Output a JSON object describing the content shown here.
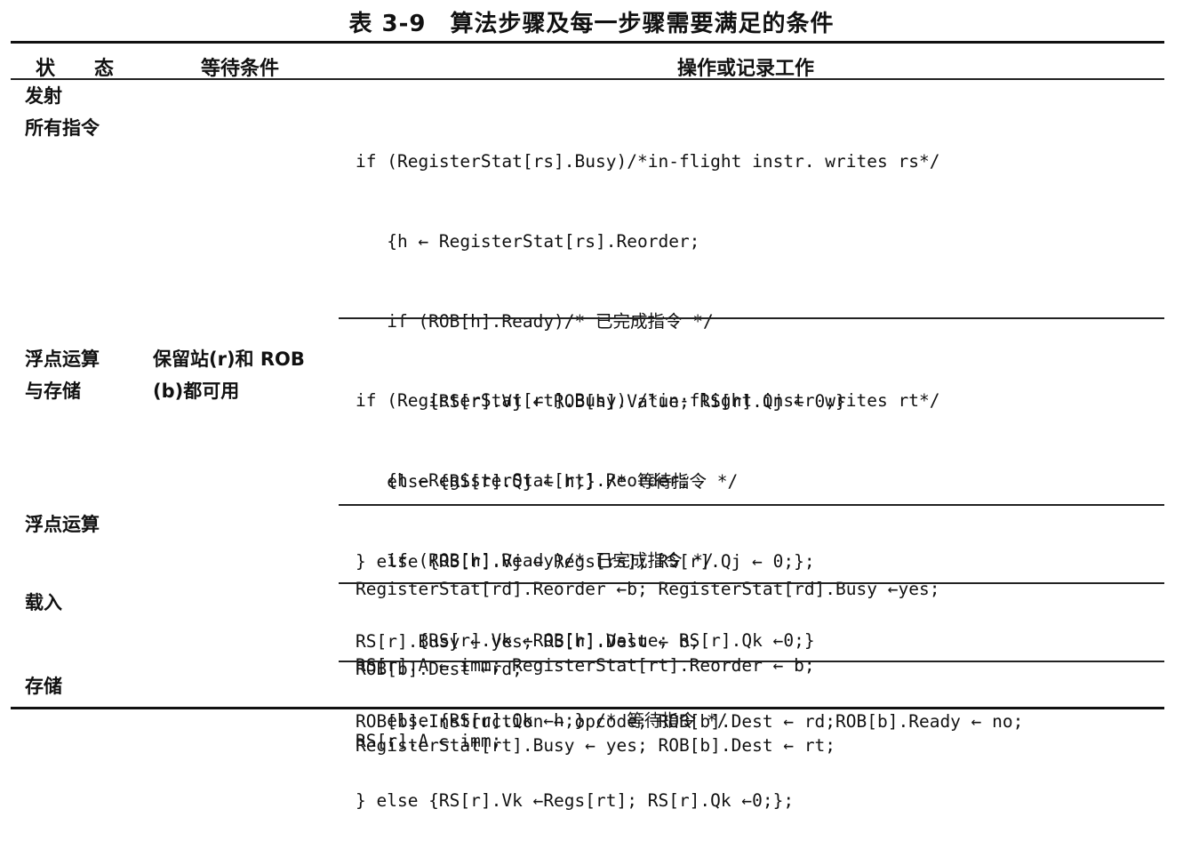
{
  "title": "表 3-9　算法步骤及每一步骤需要满足的条件",
  "columns": {
    "state": "状　　态",
    "wait": "等待条件",
    "action": "操作或记录工作"
  },
  "rows": [
    {
      "state": [
        "发射",
        "所有指令"
      ],
      "wait": [],
      "code": [
        "if (RegisterStat[rs].Busy)/*in-flight instr. writes rs*/",
        "   {h ← RegisterStat[rs].Reorder;",
        "   if (ROB[h].Ready)/* 已完成指令 */",
        "       {RS[r].Vj ← ROB[h].Value; RS[r].Qj ← 0;}",
        "   else {RS[r].Qj ← h;} /* 等待指令 */",
        "} else {RS[r].Vj ← Regs[rs]; RS[r].Qj ← 0;};",
        "RS[r].Busy ← yes; RS[r].Dest ← b;",
        "ROB[b].Instruction ← opcode; ROB[b].Dest ← rd;ROB[b].Ready ← no;"
      ]
    },
    {
      "state": [
        "浮点运算",
        "与存储"
      ],
      "wait": [
        "保留站(r)和 ROB",
        "(b)都可用"
      ],
      "code": [
        "if (RegisterStat[rt].Busy) /*in-flight instr writes rt*/",
        "   {h ←RegisterStat[rt].Reorder;",
        "   if (ROB[h].Ready)/* 已完成指令 */",
        "      {RS[r].Vk ←ROB[h].Value; RS[r].Qk ←0;}",
        "   else {RS[r].Qk ←h;} /* 等待指令 */",
        "} else {RS[r].Vk ←Regs[rt]; RS[r].Qk ←0;};"
      ]
    },
    {
      "state": [
        "浮点运算"
      ],
      "wait": [],
      "code": [
        "RegisterStat[rd].Reorder ←b; RegisterStat[rd].Busy ←yes;",
        "ROB[b].Dest ←rd;"
      ]
    },
    {
      "state": [
        "载入"
      ],
      "wait": [],
      "code": [
        "RS[r].A ← imm; RegisterStat[rt].Reorder ← b;",
        "RegisterStat[rt].Busy ← yes; ROB[b].Dest ← rt;"
      ]
    },
    {
      "state": [
        "存储"
      ],
      "wait": [],
      "code": [
        "RS[r].A ← imm;"
      ]
    }
  ]
}
